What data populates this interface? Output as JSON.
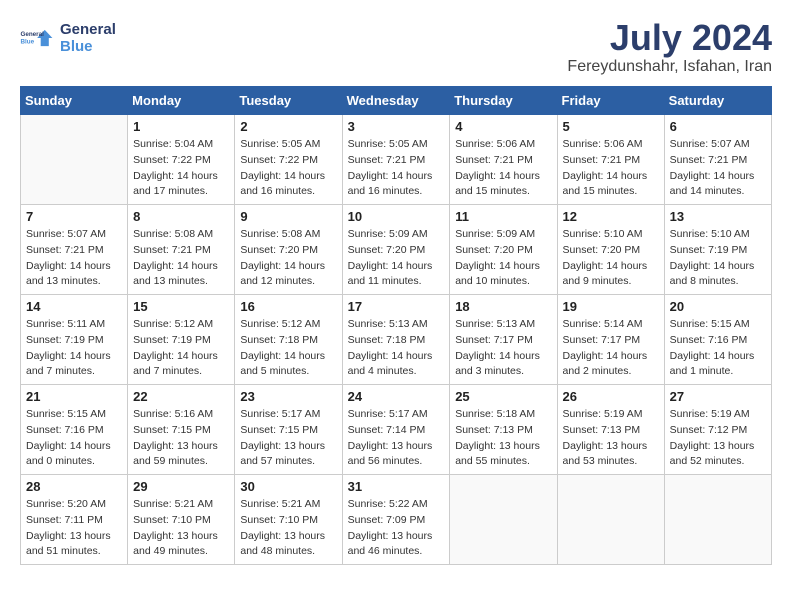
{
  "logo": {
    "line1": "General",
    "line2": "Blue"
  },
  "title": "July 2024",
  "location": "Fereydunshahr, Isfahan, Iran",
  "weekdays": [
    "Sunday",
    "Monday",
    "Tuesday",
    "Wednesday",
    "Thursday",
    "Friday",
    "Saturday"
  ],
  "weeks": [
    [
      {
        "day": "",
        "info": ""
      },
      {
        "day": "1",
        "info": "Sunrise: 5:04 AM\nSunset: 7:22 PM\nDaylight: 14 hours\nand 17 minutes."
      },
      {
        "day": "2",
        "info": "Sunrise: 5:05 AM\nSunset: 7:22 PM\nDaylight: 14 hours\nand 16 minutes."
      },
      {
        "day": "3",
        "info": "Sunrise: 5:05 AM\nSunset: 7:21 PM\nDaylight: 14 hours\nand 16 minutes."
      },
      {
        "day": "4",
        "info": "Sunrise: 5:06 AM\nSunset: 7:21 PM\nDaylight: 14 hours\nand 15 minutes."
      },
      {
        "day": "5",
        "info": "Sunrise: 5:06 AM\nSunset: 7:21 PM\nDaylight: 14 hours\nand 15 minutes."
      },
      {
        "day": "6",
        "info": "Sunrise: 5:07 AM\nSunset: 7:21 PM\nDaylight: 14 hours\nand 14 minutes."
      }
    ],
    [
      {
        "day": "7",
        "info": "Sunrise: 5:07 AM\nSunset: 7:21 PM\nDaylight: 14 hours\nand 13 minutes."
      },
      {
        "day": "8",
        "info": "Sunrise: 5:08 AM\nSunset: 7:21 PM\nDaylight: 14 hours\nand 13 minutes."
      },
      {
        "day": "9",
        "info": "Sunrise: 5:08 AM\nSunset: 7:20 PM\nDaylight: 14 hours\nand 12 minutes."
      },
      {
        "day": "10",
        "info": "Sunrise: 5:09 AM\nSunset: 7:20 PM\nDaylight: 14 hours\nand 11 minutes."
      },
      {
        "day": "11",
        "info": "Sunrise: 5:09 AM\nSunset: 7:20 PM\nDaylight: 14 hours\nand 10 minutes."
      },
      {
        "day": "12",
        "info": "Sunrise: 5:10 AM\nSunset: 7:20 PM\nDaylight: 14 hours\nand 9 minutes."
      },
      {
        "day": "13",
        "info": "Sunrise: 5:10 AM\nSunset: 7:19 PM\nDaylight: 14 hours\nand 8 minutes."
      }
    ],
    [
      {
        "day": "14",
        "info": "Sunrise: 5:11 AM\nSunset: 7:19 PM\nDaylight: 14 hours\nand 7 minutes."
      },
      {
        "day": "15",
        "info": "Sunrise: 5:12 AM\nSunset: 7:19 PM\nDaylight: 14 hours\nand 7 minutes."
      },
      {
        "day": "16",
        "info": "Sunrise: 5:12 AM\nSunset: 7:18 PM\nDaylight: 14 hours\nand 5 minutes."
      },
      {
        "day": "17",
        "info": "Sunrise: 5:13 AM\nSunset: 7:18 PM\nDaylight: 14 hours\nand 4 minutes."
      },
      {
        "day": "18",
        "info": "Sunrise: 5:13 AM\nSunset: 7:17 PM\nDaylight: 14 hours\nand 3 minutes."
      },
      {
        "day": "19",
        "info": "Sunrise: 5:14 AM\nSunset: 7:17 PM\nDaylight: 14 hours\nand 2 minutes."
      },
      {
        "day": "20",
        "info": "Sunrise: 5:15 AM\nSunset: 7:16 PM\nDaylight: 14 hours\nand 1 minute."
      }
    ],
    [
      {
        "day": "21",
        "info": "Sunrise: 5:15 AM\nSunset: 7:16 PM\nDaylight: 14 hours\nand 0 minutes."
      },
      {
        "day": "22",
        "info": "Sunrise: 5:16 AM\nSunset: 7:15 PM\nDaylight: 13 hours\nand 59 minutes."
      },
      {
        "day": "23",
        "info": "Sunrise: 5:17 AM\nSunset: 7:15 PM\nDaylight: 13 hours\nand 57 minutes."
      },
      {
        "day": "24",
        "info": "Sunrise: 5:17 AM\nSunset: 7:14 PM\nDaylight: 13 hours\nand 56 minutes."
      },
      {
        "day": "25",
        "info": "Sunrise: 5:18 AM\nSunset: 7:13 PM\nDaylight: 13 hours\nand 55 minutes."
      },
      {
        "day": "26",
        "info": "Sunrise: 5:19 AM\nSunset: 7:13 PM\nDaylight: 13 hours\nand 53 minutes."
      },
      {
        "day": "27",
        "info": "Sunrise: 5:19 AM\nSunset: 7:12 PM\nDaylight: 13 hours\nand 52 minutes."
      }
    ],
    [
      {
        "day": "28",
        "info": "Sunrise: 5:20 AM\nSunset: 7:11 PM\nDaylight: 13 hours\nand 51 minutes."
      },
      {
        "day": "29",
        "info": "Sunrise: 5:21 AM\nSunset: 7:10 PM\nDaylight: 13 hours\nand 49 minutes."
      },
      {
        "day": "30",
        "info": "Sunrise: 5:21 AM\nSunset: 7:10 PM\nDaylight: 13 hours\nand 48 minutes."
      },
      {
        "day": "31",
        "info": "Sunrise: 5:22 AM\nSunset: 7:09 PM\nDaylight: 13 hours\nand 46 minutes."
      },
      {
        "day": "",
        "info": ""
      },
      {
        "day": "",
        "info": ""
      },
      {
        "day": "",
        "info": ""
      }
    ]
  ]
}
